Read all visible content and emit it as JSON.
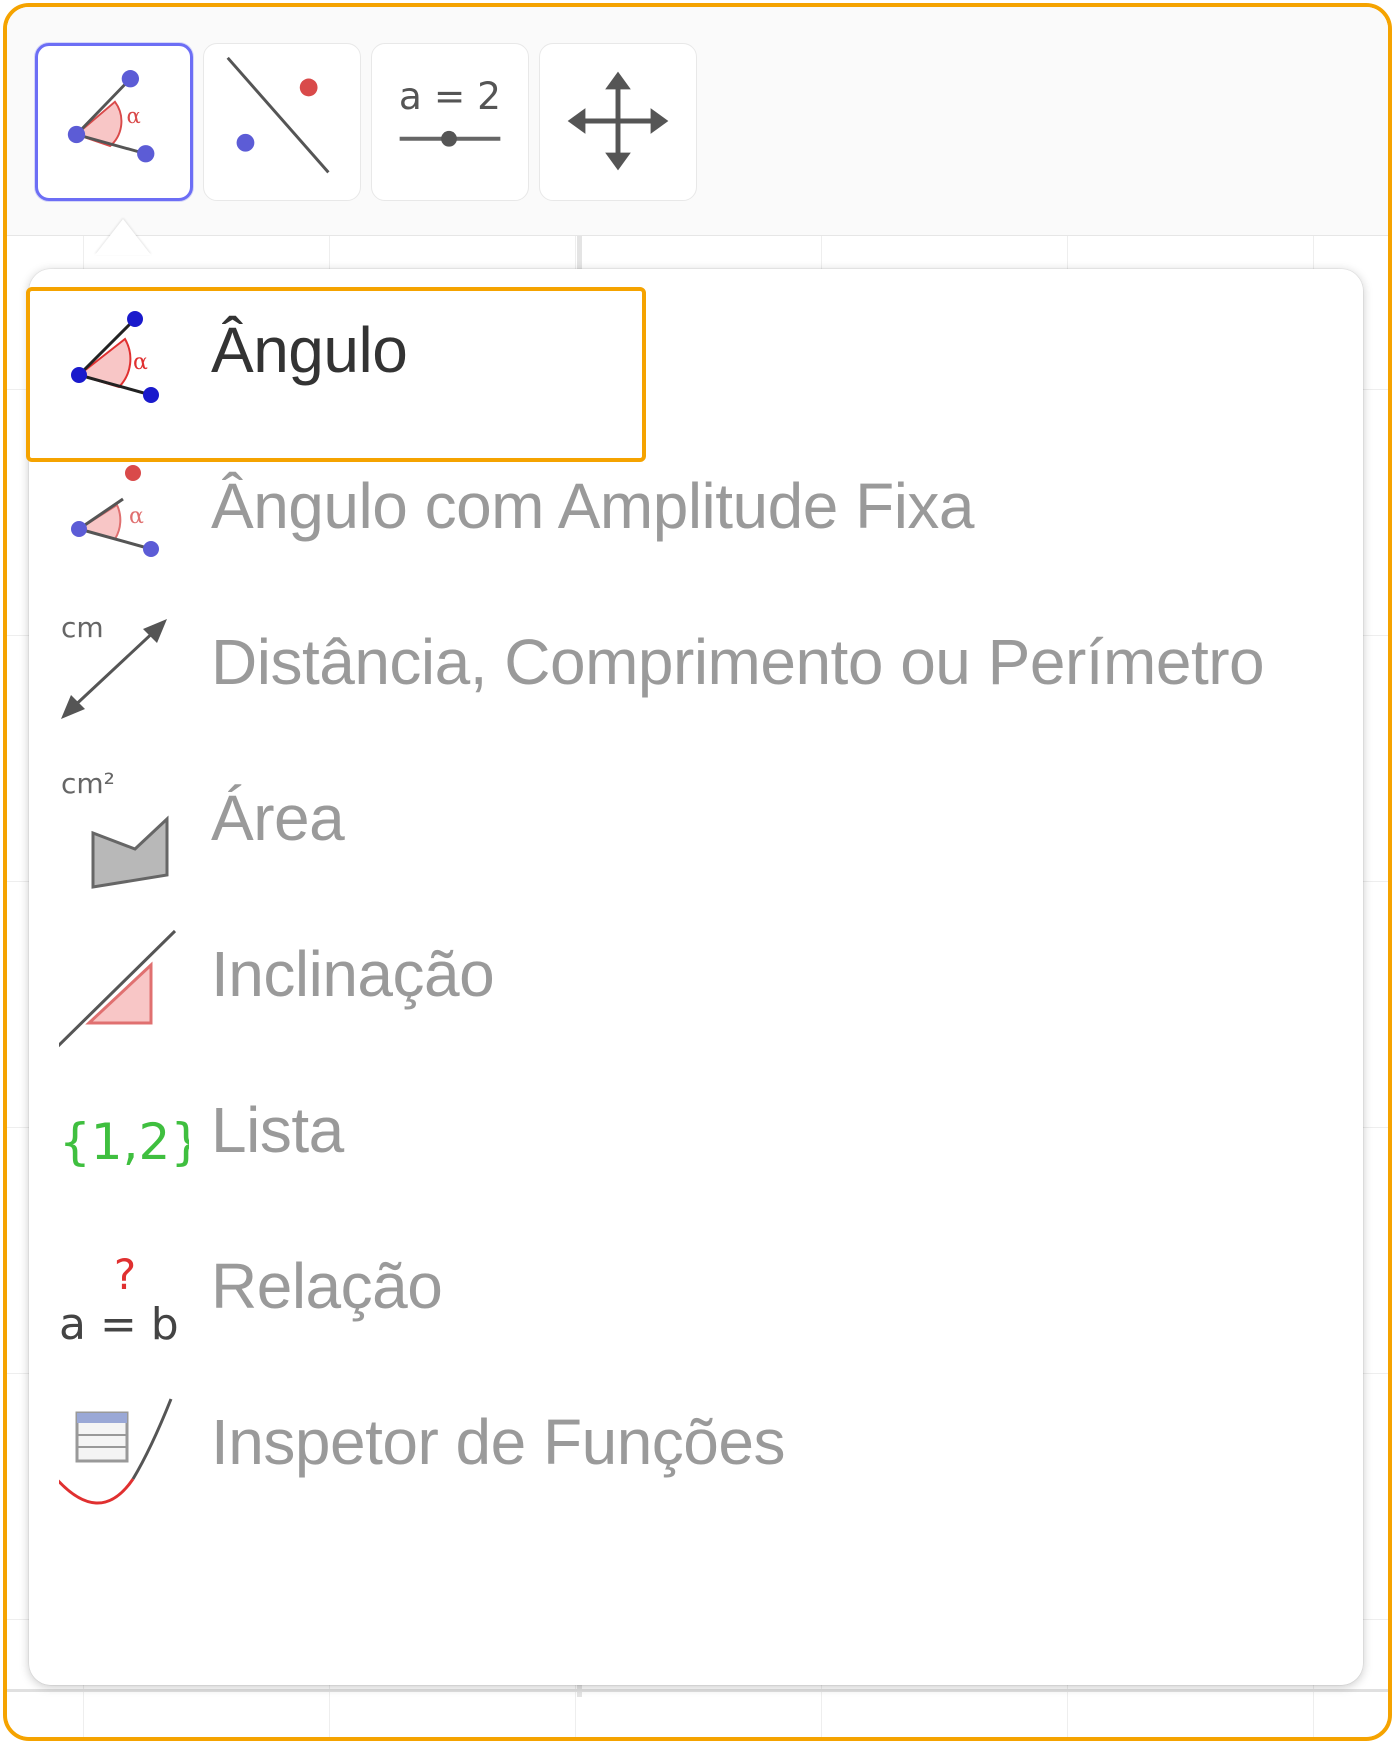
{
  "toolbar": {
    "buttons": [
      {
        "name": "angle-tool",
        "icon": "angle-icon",
        "selected": true
      },
      {
        "name": "perpendicular-line-tool",
        "icon": "perpendicular-line-icon",
        "selected": false
      },
      {
        "name": "slider-tool",
        "icon": "slider-icon",
        "label": "a = 2",
        "selected": false
      },
      {
        "name": "move-graphics-view-tool",
        "icon": "move-arrows-icon",
        "selected": false
      }
    ]
  },
  "menu": {
    "items": [
      {
        "label": "Ângulo",
        "icon": "angle-icon",
        "active": true
      },
      {
        "label": "Ângulo com Amplitude Fixa",
        "icon": "angle-fixed-size-icon",
        "active": false
      },
      {
        "label": "Distância, Comprimento ou Perímetro",
        "icon": "distance-icon",
        "icon_text": "cm",
        "active": false
      },
      {
        "label": "Área",
        "icon": "area-icon",
        "icon_text": "cm²",
        "active": false
      },
      {
        "label": "Inclinação",
        "icon": "slope-icon",
        "active": false
      },
      {
        "label": "Lista",
        "icon": "list-icon",
        "icon_text": "{1,2}",
        "active": false
      },
      {
        "label": "Relação",
        "icon": "relation-icon",
        "icon_text": "a = b",
        "icon_mark": "?",
        "active": false
      },
      {
        "label": "Inspetor de Funções",
        "icon": "function-inspector-icon",
        "active": false
      }
    ]
  },
  "colors": {
    "highlight": "#f5a300",
    "selected_tool_border": "#6c6ef5",
    "point_blue": "#5c5cd6",
    "point_red": "#d94a4a",
    "list_green": "#3fbf3f"
  }
}
